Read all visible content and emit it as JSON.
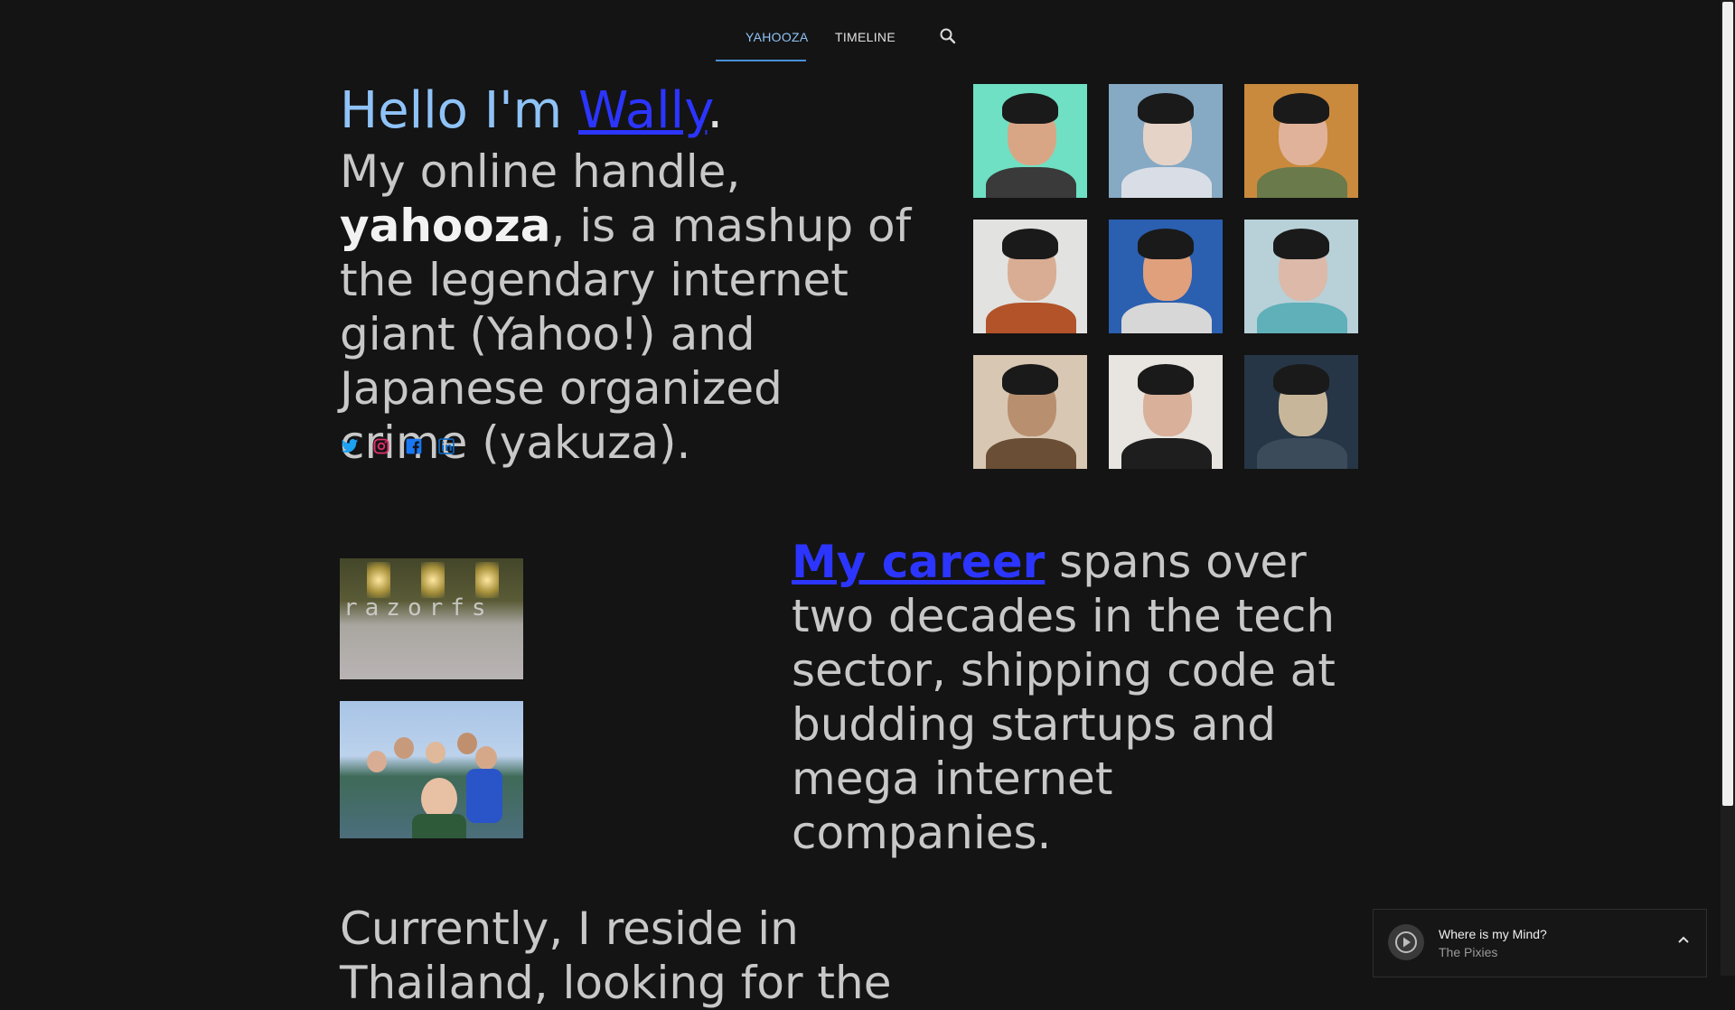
{
  "nav": {
    "tabs": [
      {
        "label": "YAHOOZA",
        "active": true
      },
      {
        "label": "TIMELINE",
        "active": false
      }
    ],
    "search_icon": "search-icon"
  },
  "hero": {
    "greeting_prefix": "Hello I'm ",
    "name": "Wally",
    "greeting_suffix": ".",
    "intro_prefix": "My online handle, ",
    "handle": "yahooza",
    "intro_suffix": ", is a mashup of the legendary internet giant (Yahoo!) and Japanese organized crime (yakuza).",
    "socials": [
      {
        "name": "twitter-icon",
        "color": "#1da1f2"
      },
      {
        "name": "instagram-icon",
        "color": "#e1306c"
      },
      {
        "name": "facebook-icon",
        "color": "#1877f2"
      },
      {
        "name": "linkedin-icon",
        "color": "#0a66c2"
      }
    ]
  },
  "portraits": [
    {
      "bg": "#6fe0c3",
      "skin": "#d9a685",
      "shirt": "#3a3a3a"
    },
    {
      "bg": "#86a9c4",
      "skin": "#e6d3c7",
      "shirt": "#d9dee6"
    },
    {
      "bg": "#ca8a3d",
      "skin": "#e0b29a",
      "shirt": "#6a7a4a"
    },
    {
      "bg": "#e2e2e0",
      "skin": "#d9ad93",
      "shirt": "#b2532a"
    },
    {
      "bg": "#2b5fb0",
      "skin": "#e0a07c",
      "shirt": "#d7d7d7"
    },
    {
      "bg": "#b8d0d8",
      "skin": "#dcb9a8",
      "shirt": "#5fb0b8"
    },
    {
      "bg": "#d8c7b3",
      "skin": "#b9906f",
      "shirt": "#6a4e35"
    },
    {
      "bg": "#e8e4e0",
      "skin": "#d9b09a",
      "shirt": "#1e1e1e"
    },
    {
      "bg": "#263646",
      "skin": "#c8b69a",
      "shirt": "#3b4b5a"
    }
  ],
  "career": {
    "link": "My career",
    "text": " spans over two decades in the tech sector, shipping code at budding startups and mega internet companies."
  },
  "currently": {
    "text": "Currently, I reside in Thailand, looking for the"
  },
  "player": {
    "song": "Where is my Mind?",
    "artist": "The Pixies"
  }
}
